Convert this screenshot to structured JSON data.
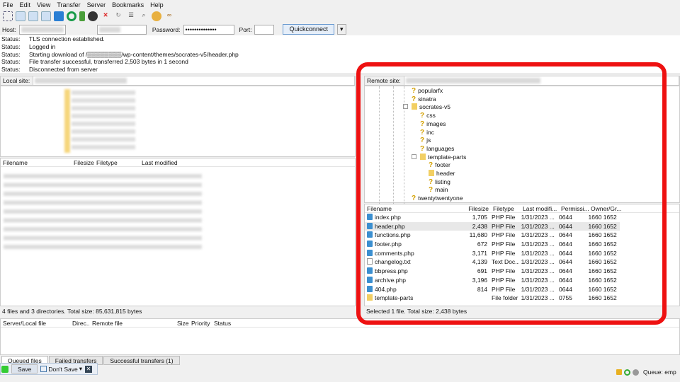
{
  "menu": [
    "File",
    "Edit",
    "View",
    "Transfer",
    "Server",
    "Bookmarks",
    "Help"
  ],
  "hostbar": {
    "host_label": "Host:",
    "password_label": "Password:",
    "password_value": "••••••••••••••",
    "port_label": "Port:",
    "port_value": "",
    "quickconnect": "Quickconnect"
  },
  "log": [
    {
      "k": "Status:",
      "v": "TLS connection established."
    },
    {
      "k": "Status:",
      "v": "Logged in"
    },
    {
      "k": "Status:",
      "v": "Starting download of /▒▒▒▒▒▒▒▒/wp-content/themes/socrates-v5/header.php"
    },
    {
      "k": "Status:",
      "v": "File transfer successful, transferred 2,503 bytes in 1 second"
    },
    {
      "k": "Status:",
      "v": "Disconnected from server"
    }
  ],
  "local": {
    "site_label": "Local site:",
    "columns": [
      "Filename",
      "Filesize",
      "Filetype",
      "Last modified"
    ],
    "status": "4 files and 3 directories. Total size: 85,631,815 bytes"
  },
  "remote": {
    "site_label": "Remote site:",
    "tree": [
      {
        "name": "popularfx",
        "icon": "question-folder",
        "lvl": 0
      },
      {
        "name": "sinatra",
        "icon": "question-folder",
        "lvl": 0
      },
      {
        "name": "socrates-v5",
        "icon": "folder",
        "lvl": 0,
        "expanded": true
      },
      {
        "name": "css",
        "icon": "question-folder",
        "lvl": 1
      },
      {
        "name": "images",
        "icon": "question-folder",
        "lvl": 1
      },
      {
        "name": "inc",
        "icon": "question-folder",
        "lvl": 1
      },
      {
        "name": "js",
        "icon": "question-folder",
        "lvl": 1
      },
      {
        "name": "languages",
        "icon": "question-folder",
        "lvl": 1
      },
      {
        "name": "template-parts",
        "icon": "folder",
        "lvl": 1,
        "expanded": true
      },
      {
        "name": "footer",
        "icon": "question-folder",
        "lvl": 2
      },
      {
        "name": "header",
        "icon": "folder",
        "lvl": 2
      },
      {
        "name": "listing",
        "icon": "question-folder",
        "lvl": 2
      },
      {
        "name": "main",
        "icon": "question-folder",
        "lvl": 2
      },
      {
        "name": "twentytwentyone",
        "icon": "question-folder",
        "lvl": 0
      }
    ],
    "columns": [
      "Filename",
      "Filesize",
      "Filetype",
      "Last modifi...",
      "Permissi...",
      "Owner/Gr..."
    ],
    "files": [
      {
        "name": "index.php",
        "size": "1,705",
        "type": "PHP File",
        "mod": "1/31/2023 ...",
        "perm": "0644",
        "owner": "1660 1652",
        "icon": "php"
      },
      {
        "name": "header.php",
        "size": "2,438",
        "type": "PHP File",
        "mod": "1/31/2023 ...",
        "perm": "0644",
        "owner": "1660 1652",
        "icon": "php",
        "selected": true
      },
      {
        "name": "functions.php",
        "size": "11,680",
        "type": "PHP File",
        "mod": "1/31/2023 ...",
        "perm": "0644",
        "owner": "1660 1652",
        "icon": "php"
      },
      {
        "name": "footer.php",
        "size": "672",
        "type": "PHP File",
        "mod": "1/31/2023 ...",
        "perm": "0644",
        "owner": "1660 1652",
        "icon": "php"
      },
      {
        "name": "comments.php",
        "size": "3,171",
        "type": "PHP File",
        "mod": "1/31/2023 ...",
        "perm": "0644",
        "owner": "1660 1652",
        "icon": "php"
      },
      {
        "name": "changelog.txt",
        "size": "4,139",
        "type": "Text Doc...",
        "mod": "1/31/2023 ...",
        "perm": "0644",
        "owner": "1660 1652",
        "icon": "txt"
      },
      {
        "name": "bbpress.php",
        "size": "691",
        "type": "PHP File",
        "mod": "1/31/2023 ...",
        "perm": "0644",
        "owner": "1660 1652",
        "icon": "php"
      },
      {
        "name": "archive.php",
        "size": "3,196",
        "type": "PHP File",
        "mod": "1/31/2023 ...",
        "perm": "0644",
        "owner": "1660 1652",
        "icon": "php"
      },
      {
        "name": "404.php",
        "size": "814",
        "type": "PHP File",
        "mod": "1/31/2023 ...",
        "perm": "0644",
        "owner": "1660 1652",
        "icon": "php"
      },
      {
        "name": "template-parts",
        "size": "",
        "type": "File folder",
        "mod": "1/31/2023 ...",
        "perm": "0755",
        "owner": "1660 1652",
        "icon": "fold"
      }
    ],
    "status": "Selected 1 file. Total size: 2,438 bytes"
  },
  "queue": {
    "columns": [
      "Server/Local file",
      "Direc...",
      "Remote file",
      "Size",
      "Priority",
      "Status"
    ],
    "tabs": [
      "Queued files",
      "Failed transfers",
      "Successful transfers (1)"
    ],
    "queue_status": "Queue: emp"
  },
  "popup": {
    "save": "Save",
    "dont_save": "Don't Save"
  },
  "colors": {
    "highlight": "#ee1111",
    "accent": "#3b8fd0"
  }
}
